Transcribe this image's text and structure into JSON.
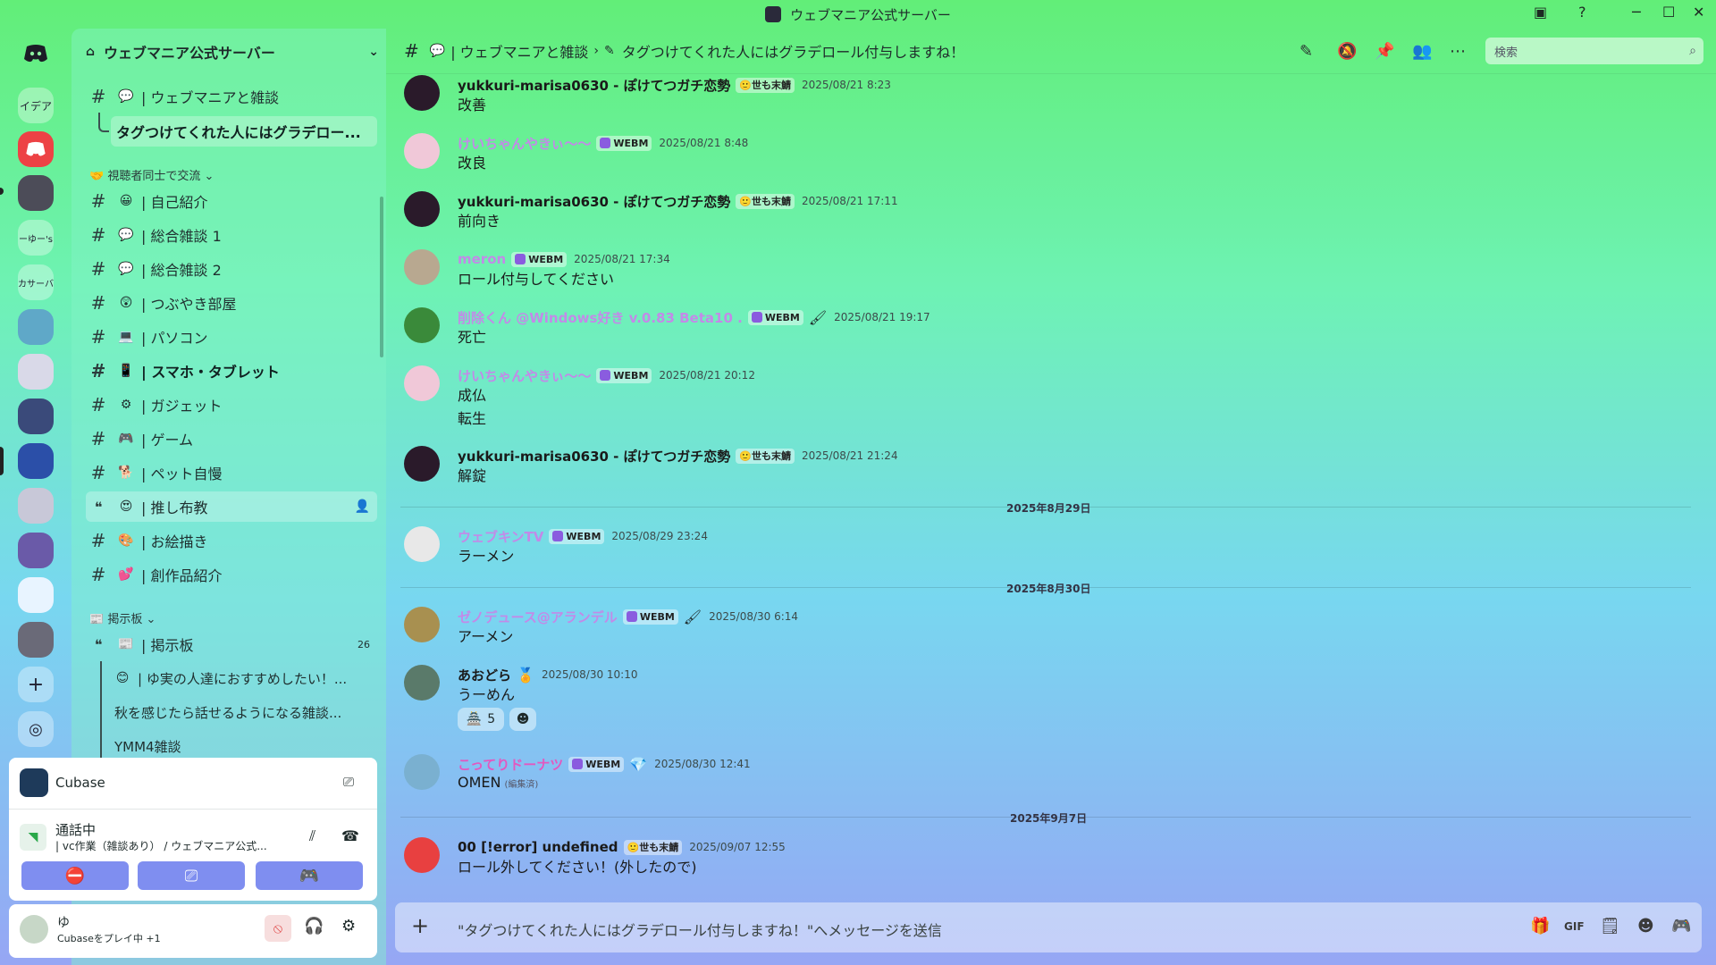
{
  "window": {
    "title": "ウェブマニア公式サーバー"
  },
  "rail": {
    "servers": [
      {
        "label": "イデア"
      },
      {
        "label": "ーゆー's"
      },
      {
        "label": "カサーバ"
      }
    ]
  },
  "sidebar": {
    "server_name": "ウェブマニア公式サーバー",
    "channels": [
      {
        "label": "| ウェブマニアと雑談",
        "emoji": "💬"
      },
      {
        "label": "タグつけてくれた人にはグラデロー..."
      },
      {
        "label": "| 自己紹介",
        "emoji": "😀"
      },
      {
        "label": "| 総合雑談 1",
        "emoji": "💬"
      },
      {
        "label": "| 総合雑談 2",
        "emoji": "💬"
      },
      {
        "label": "| つぶやき部屋",
        "emoji": "😲"
      },
      {
        "label": "| パソコン",
        "emoji": "💻"
      },
      {
        "label": "| スマホ・タブレット",
        "emoji": "📱"
      },
      {
        "label": "| ガジェット",
        "emoji": "⚙"
      },
      {
        "label": "| ゲーム",
        "emoji": "🎮"
      },
      {
        "label": "| ペット自慢",
        "emoji": "🐕"
      },
      {
        "label": "| 推し布教",
        "emoji": "😍"
      },
      {
        "label": "| お絵描き",
        "emoji": "🎨"
      },
      {
        "label": "| 創作品紹介",
        "emoji": "💕"
      },
      {
        "label": "| 掲示板",
        "emoji": "📰",
        "count": "26"
      },
      {
        "label": "| ゆ実の人達におすすめしたい！...",
        "emoji": "😊"
      },
      {
        "label": "秋を感じたら話せるようになる雑談..."
      },
      {
        "label": "YMM4雑談"
      }
    ],
    "categories": [
      {
        "label": "視聴者同士で交流"
      },
      {
        "label": "掲示板"
      }
    ]
  },
  "activity": {
    "app": "Cubase"
  },
  "voice": {
    "status": "通話中",
    "channel": "| vc作業（雑談あり） / ウェブマニア公式..."
  },
  "user": {
    "name": "ゆ",
    "status": "Cubaseをプレイ中 +1"
  },
  "header": {
    "channel": "| ウェブマニアと雑談",
    "thread": "タグつけてくれた人にはグラデロール付与しますね！",
    "search_placeholder": "検索"
  },
  "messages": [
    {
      "author": "yukkuri-marisa0630 - ぽけてつガチ恋勢",
      "tag": "世も末鯖",
      "time": "2025/08/21 8:23",
      "lines": [
        "改善"
      ]
    },
    {
      "author": "けいちゃんやきぃ〜〜",
      "tag": "WEBM",
      "time": "2025/08/21 8:48",
      "lines": [
        "改良"
      ]
    },
    {
      "author": "yukkuri-marisa0630 - ぽけてつガチ恋勢",
      "tag": "世も末鯖",
      "time": "2025/08/21 17:11",
      "lines": [
        "前向き"
      ]
    },
    {
      "author": "meron",
      "tag": "WEBM",
      "time": "2025/08/21 17:34",
      "lines": [
        "ロール付与してください"
      ]
    },
    {
      "author": "削除くん @Windows好き v.0.83 Beta10 .",
      "tag": "WEBM",
      "time": "2025/08/21 19:17",
      "lines": [
        "死亡"
      ]
    },
    {
      "author": "けいちゃんやきぃ〜〜",
      "tag": "WEBM",
      "time": "2025/08/21 20:12",
      "lines": [
        "成仏",
        "転生"
      ]
    },
    {
      "author": "yukkuri-marisa0630 - ぽけてつガチ恋勢",
      "tag": "世も末鯖",
      "time": "2025/08/21 21:24",
      "lines": [
        "解錠"
      ]
    },
    {
      "author": "ウェブキンTV",
      "tag": "WEBM",
      "time": "2025/08/29 23:24",
      "lines": [
        "ラーメン"
      ]
    },
    {
      "author": "ゼノデュース@アランデル",
      "tag": "WEBM",
      "time": "2025/08/30 6:14",
      "lines": [
        "アーメン"
      ]
    },
    {
      "author": "あおどら",
      "tag": "",
      "time": "2025/08/30 10:10",
      "lines": [
        "うーめん"
      ],
      "reaction_count": "5"
    },
    {
      "author": "こってりドーナツ",
      "tag": "WEBM",
      "time": "2025/08/30 12:41",
      "lines": [
        "OMEN"
      ],
      "edited": "(編集済)"
    },
    {
      "author": "00 [!error] undefined",
      "tag": "世も末鯖",
      "time": "2025/09/07 12:55",
      "lines": [
        "ロール外してください！(外したので)"
      ]
    }
  ],
  "dividers": [
    "2025年8月29日",
    "2025年8月30日",
    "2025年9月7日"
  ],
  "composer": {
    "placeholder": "\"タグつけてくれた人にはグラデロール付与しますね！\"へメッセージを送信"
  },
  "colors": {
    "accent": "#7f8ef0",
    "name_purple": "#c28ae8",
    "name_pink": "#e358c0"
  }
}
